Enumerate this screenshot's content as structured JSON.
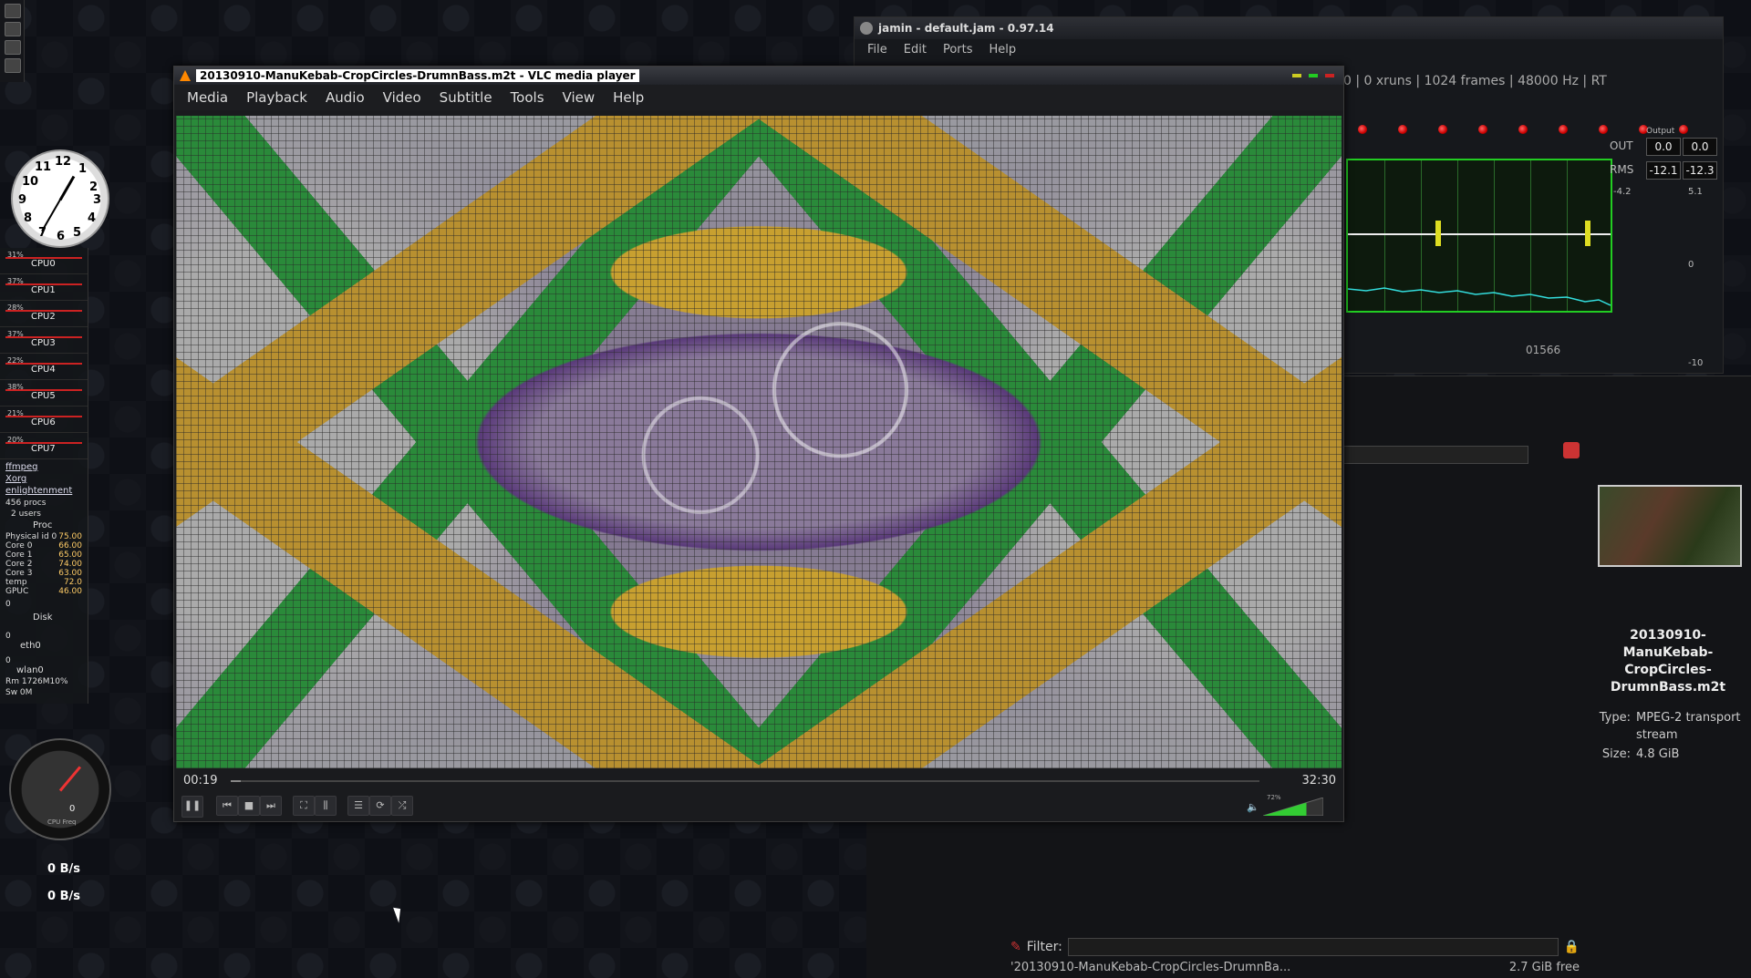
{
  "clock": {
    "numbers": [
      "12",
      "1",
      "2",
      "3",
      "4",
      "5",
      "6",
      "7",
      "8",
      "9",
      "10",
      "11"
    ]
  },
  "conky": {
    "cpus": [
      {
        "pct": "31%",
        "label": "CPU0"
      },
      {
        "pct": "37%",
        "label": "CPU1"
      },
      {
        "pct": "28%",
        "label": "CPU2"
      },
      {
        "pct": "37%",
        "label": "CPU3"
      },
      {
        "pct": "22%",
        "label": "CPU4"
      },
      {
        "pct": "38%",
        "label": "CPU5"
      },
      {
        "pct": "21%",
        "label": "CPU6"
      },
      {
        "pct": "20%",
        "label": "CPU7"
      }
    ],
    "procs": [
      "ffmpeg",
      "Xorg",
      "enlightenment"
    ],
    "procs_count": "456 procs",
    "users": "2 users",
    "section_proc": "Proc",
    "temps": [
      {
        "k": "Physical id 0",
        "v": "75.00"
      },
      {
        "k": "Core 0",
        "v": "66.00"
      },
      {
        "k": "Core 1",
        "v": "65.00"
      },
      {
        "k": "Core 2",
        "v": "74.00"
      },
      {
        "k": "Core 3",
        "v": "63.00"
      },
      {
        "k": "temp",
        "v": "72.0"
      },
      {
        "k": "GPUC",
        "v": "46.00"
      }
    ],
    "disk_label": "Disk",
    "eth_label": "eth0",
    "wlan_label": "wlan0",
    "ram": "Rm 1726M10%",
    "swap": "Sw 0M",
    "zero": "0",
    "gauge_value": "0",
    "gauge_caption": "CPU Freq",
    "net_down": "0 B/s",
    "net_up": "0 B/s"
  },
  "jamin": {
    "title": "jamin - default.jam - 0.97.14",
    "menu": [
      "File",
      "Edit",
      "Ports",
      "Help"
    ],
    "status": "0  |  0 xruns  |  1024 frames  |  48000 Hz  |  RT",
    "output_label": "Output",
    "out_label": "OUT",
    "rms_label": "RMS",
    "out_vals": [
      "0.0",
      "0.0"
    ],
    "rms_vals": [
      "-12.1",
      "-12.3"
    ],
    "scale_vals": [
      "-4.2",
      "5.1",
      "0",
      "-10"
    ],
    "freq": "01566"
  },
  "browser": {
    "file_name": "20130910-ManuKebab-CropCircles-DrumnBass.m2t",
    "file_name_lines": [
      "20130910-",
      "ManuKebab-",
      "CropCircles-",
      "DrumnBass.m2t"
    ],
    "type_label": "Type:",
    "type_value": "MPEG-2 transport stream",
    "size_label": "Size:",
    "size_value": "4.8 GiB",
    "filter_label": "Filter:",
    "status_file": "'20130910-ManuKebab-CropCircles-DrumnBa...",
    "free_space": "2.7 GiB free"
  },
  "vlc": {
    "title": "20130910-ManuKebab-CropCircles-DrumnBass.m2t - VLC media player",
    "menu": [
      "Media",
      "Playback",
      "Audio",
      "Video",
      "Subtitle",
      "Tools",
      "View",
      "Help"
    ],
    "time_elapsed": "00:19",
    "time_total": "32:30",
    "volume_level": "72%",
    "volume_fraction": 0.72,
    "progress_fraction": 0.01
  },
  "colors": {
    "accent_green": "#22cc22",
    "led_red": "#cc0000",
    "spectrum": "#33dddd"
  }
}
